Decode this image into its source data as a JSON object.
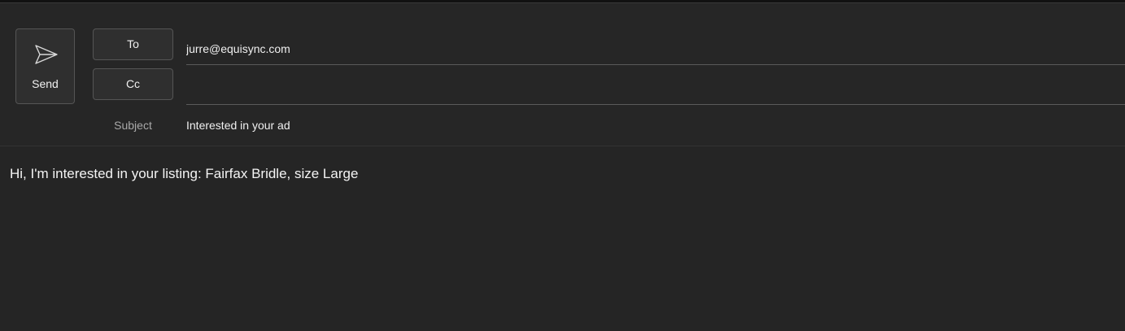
{
  "compose": {
    "send_label": "Send",
    "to_label": "To",
    "cc_label": "Cc",
    "subject_label": "Subject",
    "to_value": "jurre@equisync.com",
    "cc_value": "",
    "subject_value": "Interested in your ad",
    "body_text": "Hi, I'm interested in your listing: Fairfax Bridle, size Large"
  },
  "icons": {
    "send": "send-icon"
  }
}
